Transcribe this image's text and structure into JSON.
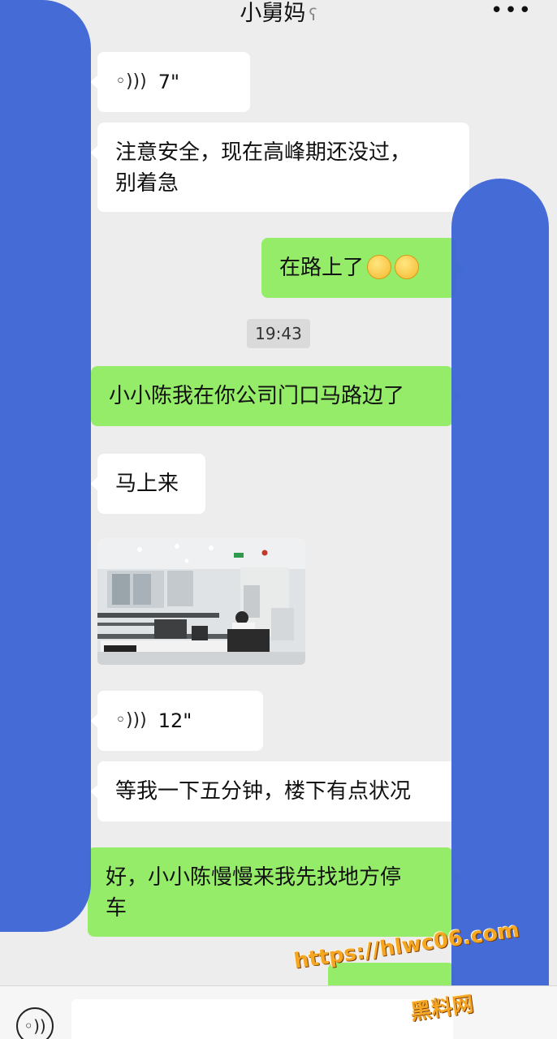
{
  "header": {
    "title": "小舅妈",
    "ear_icon": "ear-icon",
    "more_icon": "more-icon"
  },
  "messages": [
    {
      "type": "voice",
      "side": "in",
      "duration": "7\""
    },
    {
      "type": "text",
      "side": "in",
      "lines": [
        "注意安全，现在高峰期还没过，",
        "别着急"
      ]
    },
    {
      "type": "text",
      "side": "out",
      "text": "在路上了",
      "emoji": [
        "smiling-face",
        "smiling-face"
      ]
    },
    {
      "type": "time",
      "text": "19:43"
    },
    {
      "type": "text",
      "side": "out",
      "text": "小小陈我在你公司门口马路边了"
    },
    {
      "type": "text",
      "side": "in",
      "text": "马上来"
    },
    {
      "type": "image",
      "side": "in",
      "subject": "office-photo"
    },
    {
      "type": "voice",
      "side": "in",
      "duration": "12\""
    },
    {
      "type": "text",
      "side": "in",
      "text": "等我一下五分钟，楼下有点状况"
    },
    {
      "type": "text",
      "side": "out",
      "lines": [
        "好，小小陈慢慢来我先找地方停",
        "车"
      ]
    }
  ],
  "input_bar": {
    "voice_icon": "voice-input-icon",
    "text_value": ""
  },
  "watermark": {
    "url": "https://hlwc06.com",
    "name": "黑料网"
  },
  "colors": {
    "background": "#ededed",
    "incoming_bubble": "#ffffff",
    "outgoing_bubble": "#95ec69",
    "redaction_smear": "#3f66d6",
    "watermark": "#f5a623"
  }
}
